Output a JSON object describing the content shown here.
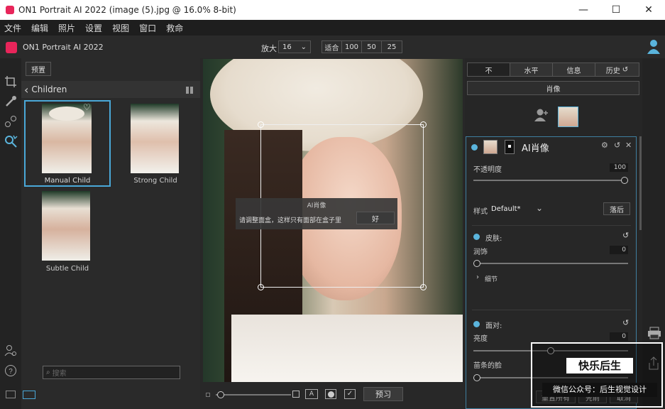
{
  "window": {
    "title": "ON1 Portrait AI 2022 (image (5).jpg @ 16.0% 8-bit)",
    "minimize": "—",
    "maximize": "☐",
    "close": "✕"
  },
  "menu": [
    "文件",
    "编辑",
    "照片",
    "设置",
    "视图",
    "窗口",
    "救命"
  ],
  "app": {
    "name": "ON1 Portrait AI 2022"
  },
  "zoom": {
    "label": "放大",
    "value": "16",
    "fit": "适合",
    "presets": [
      "100",
      "50",
      "25"
    ]
  },
  "browser": {
    "preview_button": "预置",
    "folder": "Children",
    "search_placeholder": "搜索",
    "items": [
      {
        "label": "Manual Child"
      },
      {
        "label": "Strong Child"
      },
      {
        "label": "Subtle Child"
      }
    ]
  },
  "dialog": {
    "title": "AI肖像",
    "message": "请调整面盒，这样只有面部在盒子里",
    "ok": "好"
  },
  "bottom": {
    "preview": "预习"
  },
  "right": {
    "tabs": [
      "不",
      "水平",
      "信息",
      "历史"
    ],
    "portrait_button": "肖像",
    "panel_title": "AI肖像",
    "opacity_label": "不透明度",
    "opacity_value": "100",
    "opacity": 1.0,
    "style_label": "样式",
    "style_value": "Default*",
    "apply_button": "落后",
    "skin_label": "皮肤:",
    "smooth_label": "润饰",
    "smooth_value": "0",
    "smooth": 0,
    "details_label": "细节",
    "face_label": "面对:",
    "brightness_label": "亮度",
    "brightness_value": "0",
    "brightness": 0.5,
    "slim_label": "苗条的脸",
    "slim": 0,
    "buttons": [
      "重置所有",
      "先前",
      "取消"
    ]
  },
  "watermark": {
    "line1": "快乐后生",
    "line2": "微信公众号：后生视觉设计"
  },
  "colors": {
    "accent": "#5ab4dc",
    "brand": "#e8255a"
  }
}
